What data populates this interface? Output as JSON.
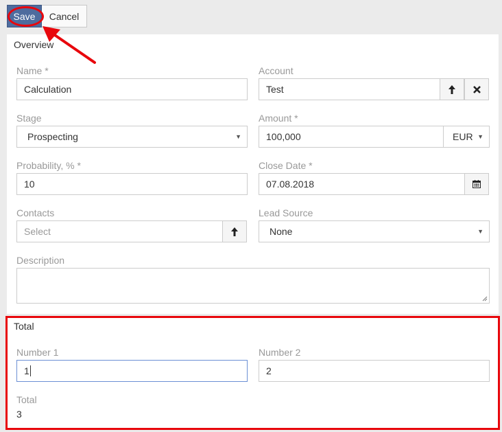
{
  "toolbar": {
    "save_label": "Save",
    "cancel_label": "Cancel"
  },
  "overview": {
    "title": "Overview",
    "name": {
      "label": "Name *",
      "value": "Calculation"
    },
    "account": {
      "label": "Account",
      "value": "Test"
    },
    "stage": {
      "label": "Stage",
      "value": "Prospecting"
    },
    "amount": {
      "label": "Amount *",
      "value": "100,000",
      "currency": "EUR"
    },
    "probability": {
      "label": "Probability, % *",
      "value": "10"
    },
    "close_date": {
      "label": "Close Date *",
      "value": "07.08.2018"
    },
    "contacts": {
      "label": "Contacts",
      "placeholder": "Select"
    },
    "lead_source": {
      "label": "Lead Source",
      "value": "None"
    },
    "description": {
      "label": "Description",
      "value": ""
    }
  },
  "total_panel": {
    "title": "Total",
    "number1": {
      "label": "Number 1",
      "value": "1"
    },
    "number2": {
      "label": "Number 2",
      "value": "2"
    },
    "total": {
      "label": "Total",
      "value": "3"
    }
  },
  "icons": {
    "upload": "arrow-up-icon",
    "clear": "close-icon",
    "calendar": "calendar-icon",
    "caret": "caret-down-icon"
  },
  "colors": {
    "save_button": "#4e6c9e",
    "annotation": "#e8070c",
    "focus_border": "#6b8fd4"
  }
}
